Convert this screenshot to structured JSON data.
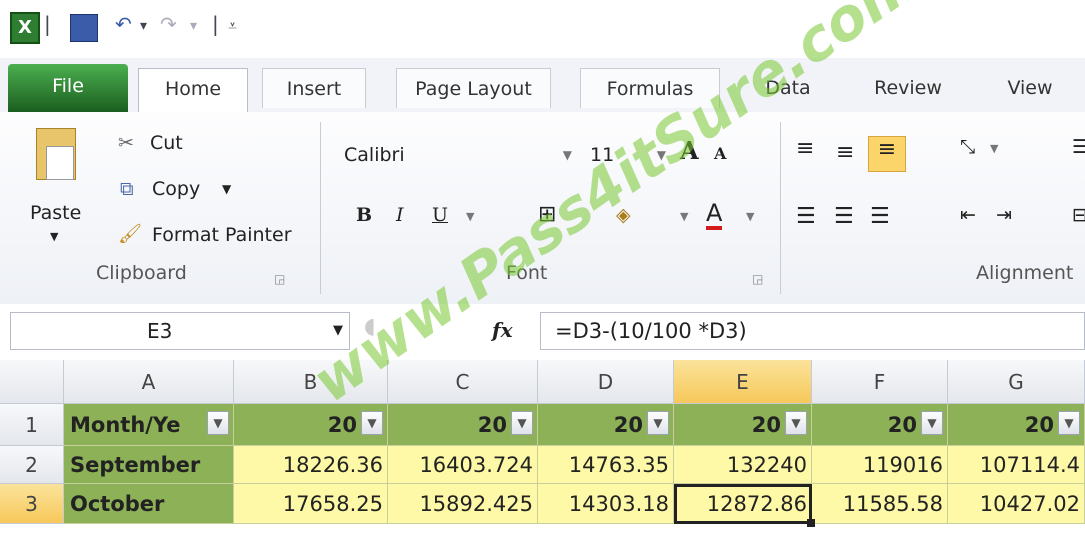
{
  "quick_access": {
    "excel_icon": "excel-icon",
    "save_icon": "save-icon",
    "undo_icon": "undo-icon",
    "redo_icon": "redo-icon",
    "customize_icon": "customize-icon",
    "sep": "|",
    "dropdown": "▾"
  },
  "tabs": [
    "File",
    "Home",
    "Insert",
    "Page Layout",
    "Formulas",
    "Data",
    "Review",
    "View"
  ],
  "clipboard": {
    "paste": "Paste",
    "cut": "Cut",
    "copy": "Copy",
    "format_painter": "Format Painter",
    "group_label": "Clipboard"
  },
  "font": {
    "font_name": "Calibri",
    "font_size": "11",
    "bold": "B",
    "italic": "I",
    "underline": "U",
    "grow": "A",
    "shrink": "A",
    "font_color": "A",
    "group_label": "Font"
  },
  "alignment": {
    "group_label": "Alignment"
  },
  "formula_bar": {
    "name_box": "E3",
    "fx": "fx",
    "formula": "=D3-(10/100 *D3)"
  },
  "columns": [
    "A",
    "B",
    "C",
    "D",
    "E",
    "F",
    "G"
  ],
  "rows": [
    "1",
    "2",
    "3"
  ],
  "table": {
    "header": [
      "Month/Ye",
      "20",
      "20",
      "20",
      "20",
      "20",
      "20"
    ],
    "r2": [
      "September",
      "18226.36",
      "16403.724",
      "14763.35",
      "132240",
      "119016",
      "107114.4"
    ],
    "r3": [
      "October",
      "17658.25",
      "15892.425",
      "14303.18",
      "12872.86",
      "11585.58",
      "10427.02"
    ]
  },
  "watermark": "www.Pass4itSure.com",
  "colors": {
    "file_tab": "#2e7d32",
    "header_cell": "#8db157",
    "value_cell": "#fdf9a7",
    "selected_header": "#f6c85a"
  }
}
